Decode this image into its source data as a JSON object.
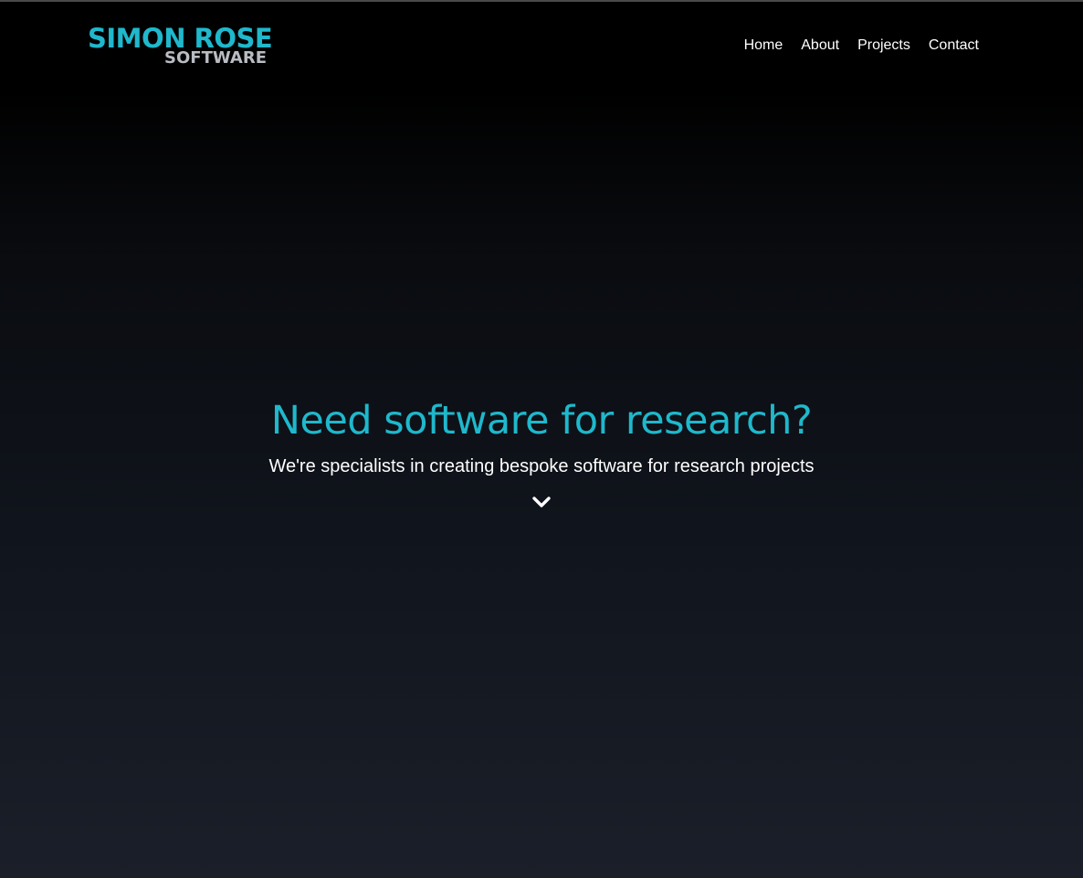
{
  "header": {
    "logo": {
      "line1": "SIMON ROSE",
      "line2": "SOFTWARE"
    },
    "nav": [
      {
        "label": "Home"
      },
      {
        "label": "About"
      },
      {
        "label": "Projects"
      },
      {
        "label": "Contact"
      }
    ]
  },
  "hero": {
    "title": "Need software for research?",
    "subtitle": "We're specialists in creating bespoke software for research projects",
    "scroll_icon": "chevron-down-icon"
  },
  "colors": {
    "accent": "#1fb8cc",
    "logo_secondary": "#b9bcc2",
    "background_top": "#000000",
    "background_bottom": "#1b1f29",
    "text": "#ffffff"
  }
}
